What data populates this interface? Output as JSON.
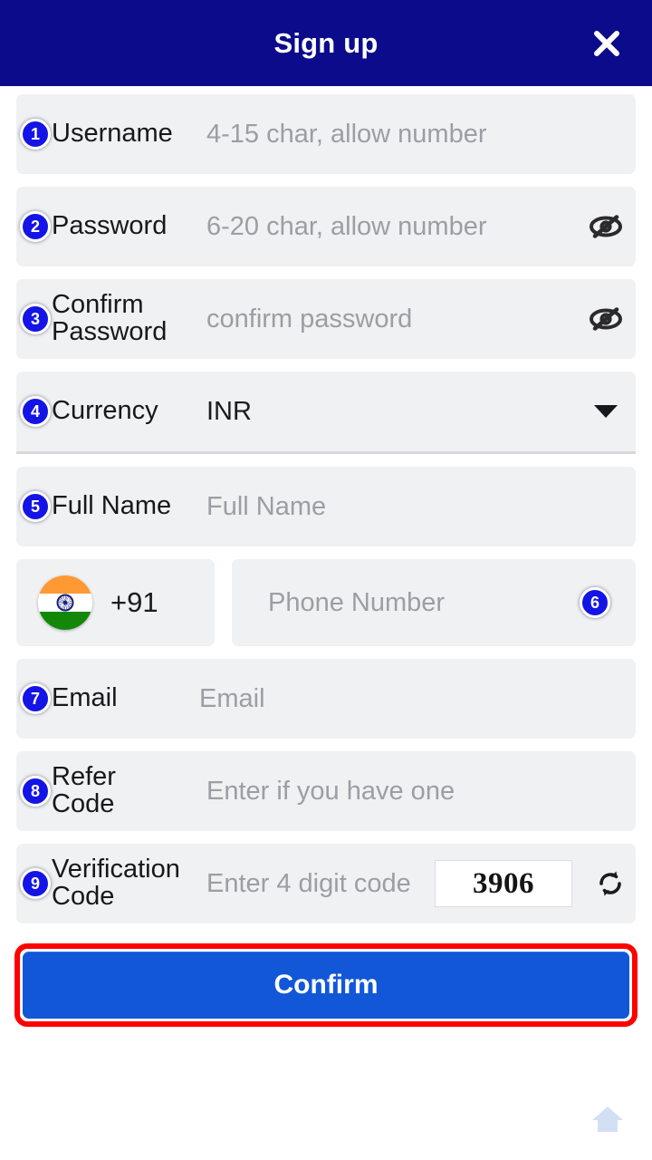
{
  "header": {
    "title": "Sign up",
    "close_icon": "close-icon",
    "bg_color": "#0b0b8b"
  },
  "fields": [
    {
      "badge": "1",
      "label": "Username",
      "placeholder": "4-15 char, allow number",
      "value": ""
    },
    {
      "badge": "2",
      "label": "Password",
      "placeholder": "6-20 char, allow number",
      "value": "",
      "trailing_icon": "eye-off-icon"
    },
    {
      "badge": "3",
      "label": "Confirm\nPassword",
      "placeholder": "confirm password",
      "value": "",
      "trailing_icon": "eye-off-icon"
    },
    {
      "badge": "4",
      "label": "Currency",
      "value": "INR",
      "trailing_icon": "chevron-down-icon"
    },
    {
      "badge": "5",
      "label": "Full Name",
      "placeholder": "Full Name",
      "value": ""
    }
  ],
  "phone": {
    "badge": "6",
    "flag_icon": "india-flag-icon",
    "dial_code": "+91",
    "placeholder": "Phone Number",
    "value": ""
  },
  "email": {
    "badge": "7",
    "label": "Email",
    "placeholder": "Email",
    "value": ""
  },
  "refer": {
    "badge": "8",
    "label": "Refer\nCode",
    "placeholder": "Enter if you have one",
    "value": ""
  },
  "verification": {
    "badge": "9",
    "label": "Verification\nCode",
    "placeholder": "Enter 4 digit code",
    "value": "",
    "captcha_code": "3906",
    "refresh_icon": "refresh-icon"
  },
  "confirm": {
    "label": "Confirm",
    "button_color": "#1157d8",
    "highlight_color": "#fd0000"
  },
  "fab": {
    "icon": "home-icon"
  },
  "colors": {
    "header_navy": "#0b0b8b",
    "badge_blue": "#1414e6",
    "field_bg": "#f0f1f3",
    "placeholder_gray": "#9b9ea3"
  }
}
